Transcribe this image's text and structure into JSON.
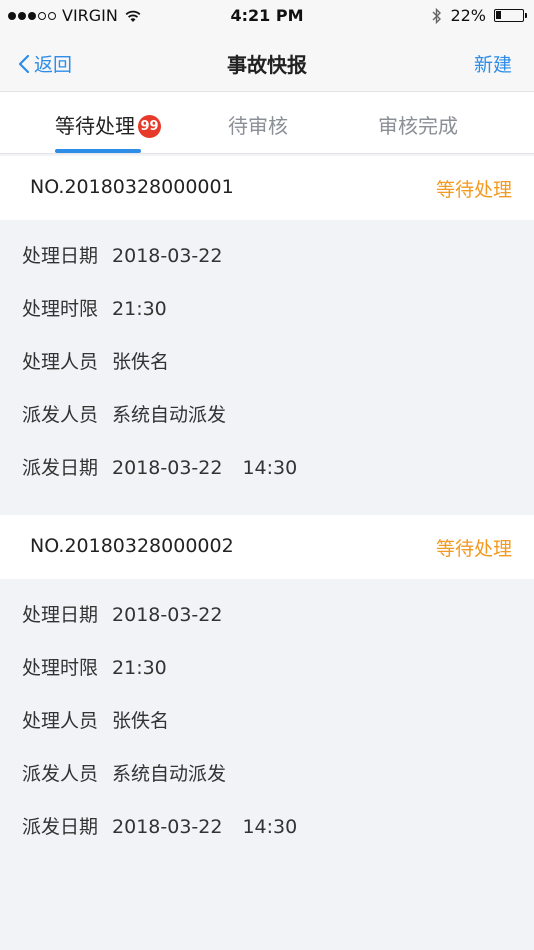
{
  "status_bar": {
    "carrier": "VIRGIN",
    "time": "4:21 PM",
    "battery": "22%",
    "battery_level": 0.22
  },
  "nav": {
    "back_label": "返回",
    "title": "事故快报",
    "right_label": "新建"
  },
  "tabs": [
    {
      "label": "等待处理",
      "badge": "99"
    },
    {
      "label": "待审核"
    },
    {
      "label": "审核完成"
    }
  ],
  "orders": [
    {
      "number": "NO.20180328000001",
      "status": "等待处理",
      "fields": [
        {
          "label": "处理日期",
          "value": "2018-03-22"
        },
        {
          "label": "处理时限",
          "value": "21:30"
        },
        {
          "label": "处理人员",
          "value": "张佚名"
        },
        {
          "label": "派发人员",
          "value": "系统自动派发"
        },
        {
          "label": "派发日期",
          "value": "2018-03-22",
          "value2": "14:30"
        }
      ]
    },
    {
      "number": "NO.20180328000002",
      "status": "等待处理",
      "fields": [
        {
          "label": "处理日期",
          "value": "2018-03-22"
        },
        {
          "label": "处理时限",
          "value": "21:30"
        },
        {
          "label": "处理人员",
          "value": "张佚名"
        },
        {
          "label": "派发人员",
          "value": "系统自动派发"
        },
        {
          "label": "派发日期",
          "value": "2018-03-22",
          "value2": "14:30"
        }
      ]
    }
  ],
  "colors": {
    "accent": "#2e8de6",
    "status": "#f39a22",
    "badge": "#e63b2a"
  }
}
